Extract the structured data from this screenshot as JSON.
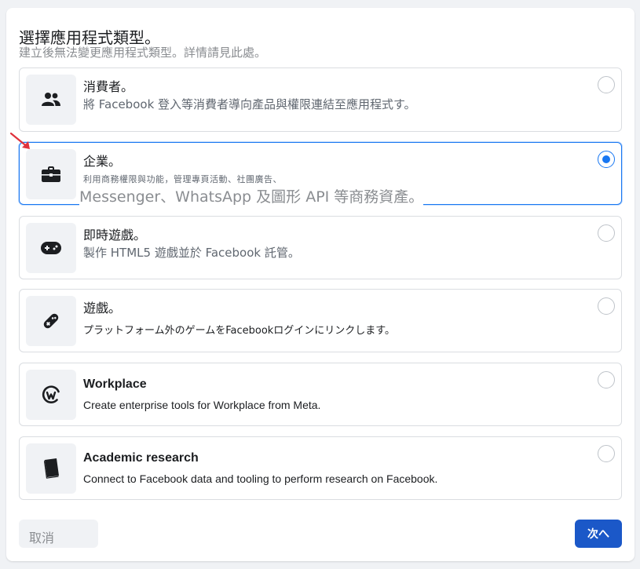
{
  "header": {
    "title": "選擇應用程式類型。",
    "subtitle": "建立後無法變更應用程式類型。詳情請見此處。"
  },
  "options": [
    {
      "id": "consumer",
      "title": "消費者。",
      "description": "將 Facebook 登入等消費者導向產品與權限連結至應用程式す。",
      "icon": "people-icon",
      "selected": false
    },
    {
      "id": "business",
      "title": "企業。",
      "description_line1": "利用商務權限與功能，管理專頁活動、社團廣告、",
      "description_line2": "Messenger、WhatsApp 及圖形 API 等商務資產。",
      "icon": "briefcase-icon",
      "selected": true
    },
    {
      "id": "instant-games",
      "title": "即時遊戲。",
      "description": "製作 HTML5 遊戲並於 Facebook 託管。",
      "icon": "gamepad-icon",
      "selected": false
    },
    {
      "id": "gaming",
      "title": "遊戲。",
      "description": "プラットフォーム外のゲームをFacebookログインにリンクします。",
      "icon": "game-controller-icon",
      "selected": false
    },
    {
      "id": "workplace",
      "title": "Workplace",
      "description": "Create enterprise tools for Workplace from Meta.",
      "icon": "workplace-icon",
      "selected": false
    },
    {
      "id": "academic-research",
      "title": "Academic research",
      "description": "Connect to Facebook data and tooling to perform research on Facebook.",
      "icon": "book-icon",
      "selected": false
    }
  ],
  "footer": {
    "cancel_label": "取消",
    "next_label": "次へ"
  },
  "colors": {
    "accent": "#1877f2",
    "next_button": "#1b58c8",
    "annotation_arrow": "#e0323c"
  }
}
